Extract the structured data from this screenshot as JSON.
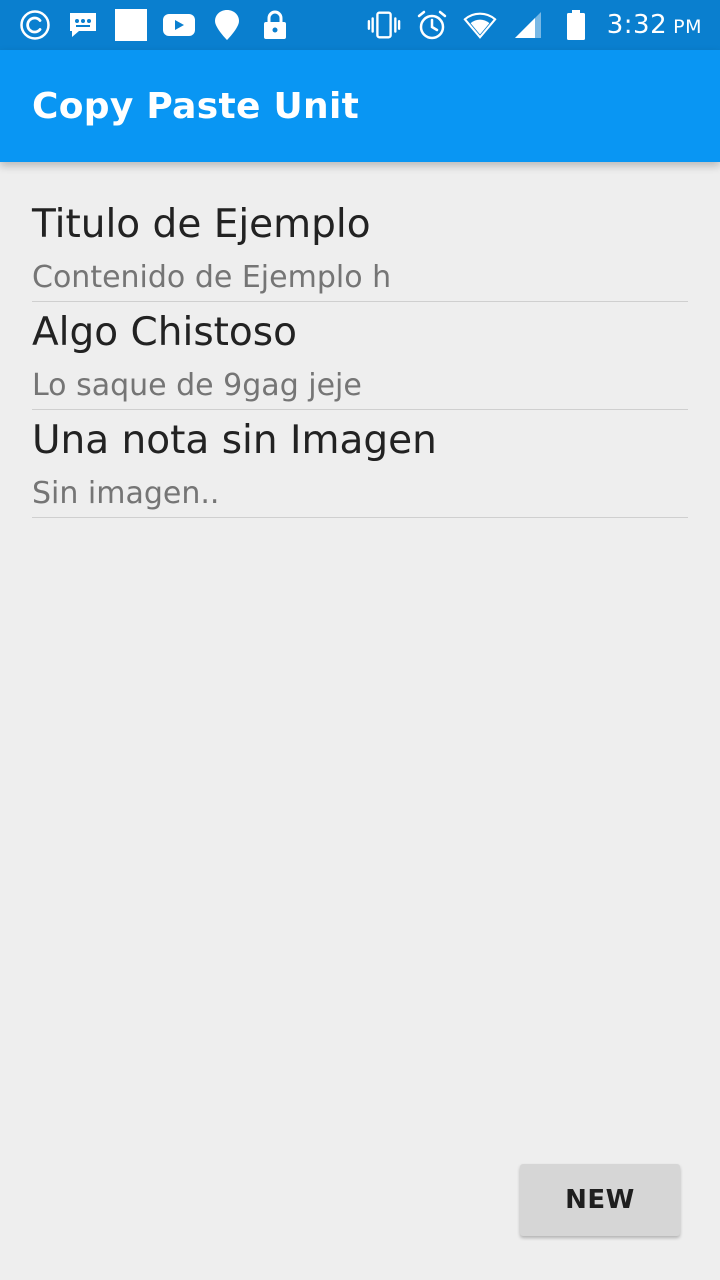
{
  "status_bar": {
    "left_icons": [
      "copyright-circle-icon",
      "chat-bubble-icon",
      "blank-square-icon",
      "youtube-icon",
      "location-pin-icon",
      "lock-icon"
    ],
    "right_icons": [
      "vibrate-icon",
      "alarm-clock-icon",
      "wifi-icon",
      "cellular-signal-icon",
      "battery-icon"
    ],
    "time": "3:32",
    "ampm": "PM",
    "background_color": "#0a7fcf"
  },
  "app_bar": {
    "title": "Copy Paste Unit",
    "background_color": "#0996f3"
  },
  "notes": [
    {
      "title": "Titulo de Ejemplo",
      "subtitle": "Contenido de Ejemplo h"
    },
    {
      "title": "Algo Chistoso",
      "subtitle": "Lo saque de 9gag jeje"
    },
    {
      "title": "Una nota sin Imagen",
      "subtitle": "Sin imagen.."
    }
  ],
  "new_button": {
    "label": "NEW"
  }
}
